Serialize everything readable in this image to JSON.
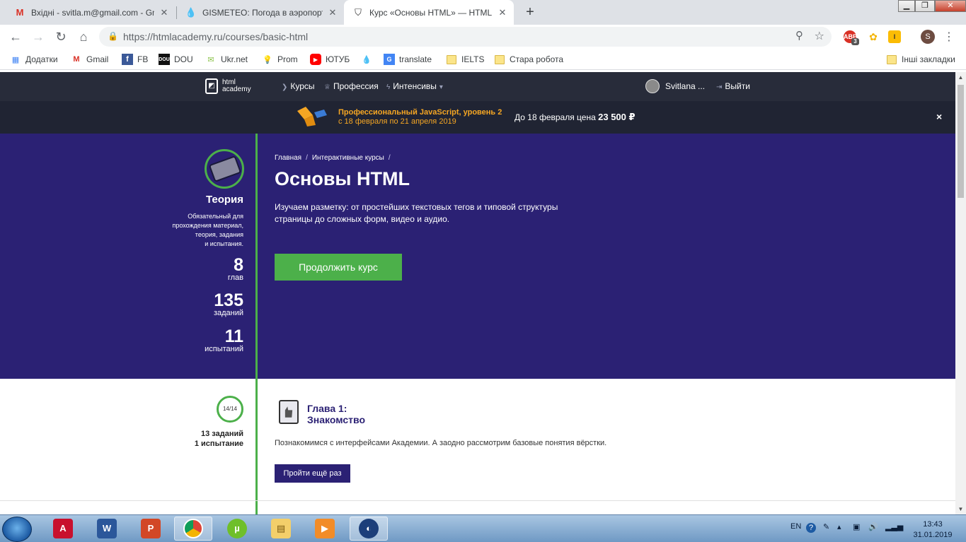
{
  "browser": {
    "tabs": [
      {
        "title": "Вхідні - svitla.m@gmail.com - Gm",
        "icon": "gmail-icon"
      },
      {
        "title": "GISMETEO: Погода в аэропорту",
        "icon": "gismeteo-icon"
      },
      {
        "title": "Курс «Основы HTML» — HTML A",
        "icon": "htmlacademy-icon"
      }
    ],
    "url": "https://htmlacademy.ru/courses/basic-html",
    "ext_badge": "3",
    "profile_initial": "S",
    "bookmarks": [
      "Додатки",
      "Gmail",
      "FB",
      "DOU",
      "Ukr.net",
      "Prom",
      "ЮТУБ",
      "",
      "translate",
      "IELTS",
      "Стара робота"
    ],
    "other_bookmarks": "Інші закладки"
  },
  "site": {
    "logo_line1": "html",
    "logo_line2": "academy",
    "nav": [
      "Курсы",
      "Профессия",
      "Интенсивы"
    ],
    "user_name": "Svitlana ...",
    "logout": "Выйти"
  },
  "promo": {
    "title": "Профессиональный JavaScript, уровень 2",
    "dates": "с 18 февраля по 21 апреля 2019",
    "price_label": "До 18 февраля цена",
    "price": "23 500 ₽",
    "close": "×"
  },
  "course": {
    "breadcrumb": [
      "Главная",
      "Интерактивные курсы"
    ],
    "title": "Основы HTML",
    "lead": "Изучаем разметку: от простейших текстовых тегов и типовой структуры страницы до сложных форм, видео и аудио.",
    "continue_label": "Продолжить курс",
    "theory_title": "Теория",
    "theory_desc": [
      "Обязательный для",
      "прохождения материал,",
      "теория, задания",
      "и испытания."
    ],
    "stats": [
      {
        "value": "8",
        "label": "глав"
      },
      {
        "value": "135",
        "label": "заданий"
      },
      {
        "value": "11",
        "label": "испытаний"
      }
    ]
  },
  "chapter": {
    "progress": "14/14",
    "tasks": "13 заданий",
    "tests": "1 испытание",
    "title_line1": "Глава 1:",
    "title_line2": "Знакомство",
    "desc": "Познакомимся с интерфейсами Академии. А заодно рассмотрим базовые понятия вёрстки.",
    "again_label": "Пройти ещё раз"
  },
  "taskbar": {
    "lang": "EN",
    "time": "13:43",
    "date": "31.01.2019"
  },
  "colors": {
    "hero_bg": "#2b2174",
    "accent_green": "#4cb04a",
    "promo_orange": "#f5a623"
  }
}
